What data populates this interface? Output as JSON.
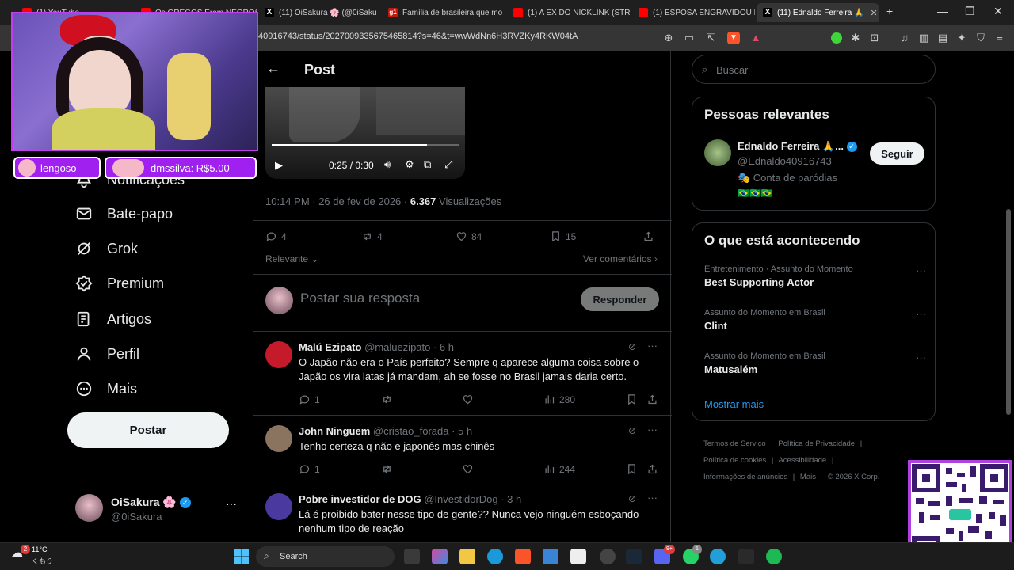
{
  "browser": {
    "tabs": [
      {
        "label": "(1) YouTube",
        "favicon": "youtube-icon",
        "color": "#ff0000"
      },
      {
        "label": "Os GREGOS Eram NEGROS",
        "favicon": "youtube-icon",
        "color": "#ff0000"
      },
      {
        "label": "(11) OiSakura 🌸 (@0iSaku",
        "favicon": "x-icon",
        "color": "#000000"
      },
      {
        "label": "Família de brasileira que mo",
        "favicon": "g1-icon",
        "color": "#c4170c"
      },
      {
        "label": "(1) A EX DO NICKLINK (STR",
        "favicon": "youtube-icon",
        "color": "#ff0000"
      },
      {
        "label": "(1) ESPOSA ENGRAVIDOU D",
        "favicon": "youtube-icon",
        "color": "#ff0000"
      },
      {
        "label": "(11) Ednaldo Ferreira 🙏",
        "favicon": "x-icon",
        "color": "#000000"
      }
    ],
    "new_tab": "+",
    "url": "40916743/status/2027009335675465814?s=46&t=wwWdNn6H3RVZKy4RKW04tA"
  },
  "stream": {
    "donation_left": "lengoso",
    "donation_right": "dmssilva: R$5.00"
  },
  "sidebar": {
    "items": [
      {
        "label": "Notificações",
        "icon": "bell-icon"
      },
      {
        "label": "Bate-papo",
        "icon": "mail-icon"
      },
      {
        "label": "Grok",
        "icon": "grok-icon"
      },
      {
        "label": "Premium",
        "icon": "verified-icon"
      },
      {
        "label": "Artigos",
        "icon": "article-icon"
      },
      {
        "label": "Perfil",
        "icon": "person-icon"
      },
      {
        "label": "Mais",
        "icon": "more-circle-icon"
      }
    ],
    "post_button": "Postar",
    "account": {
      "name": "OiSakura 🌸",
      "handle": "@0iSakura"
    }
  },
  "post": {
    "header_title": "Post",
    "video": {
      "time": "0:25 / 0:30",
      "progress": 0.83
    },
    "meta_time": "10:14 PM · 26 de fev de 2026 · ",
    "views_count": "6.367",
    "views_label": " Visualizações",
    "stats": {
      "replies": "4",
      "reposts": "4",
      "likes": "84",
      "bookmarks": "15"
    },
    "sort_label": "Relevante",
    "see_comments": "Ver comentários",
    "reply_placeholder": "Postar sua resposta",
    "reply_button": "Responder"
  },
  "replies": [
    {
      "name": "Malú Ezipato",
      "handle": "@maluezipato · 6 h",
      "text": "O Japão não era o País perfeito? Sempre q aparece alguma coisa sobre o Japão os vira latas já mandam, ah se fosse no Brasil jamais daria certo.",
      "replies": "1",
      "views": "280",
      "avatar_color": "#c41a2a"
    },
    {
      "name": "John Ninguem",
      "handle": "@cristao_forada · 5 h",
      "text": "Tenho certeza q não e japonês mas chinês",
      "replies": "1",
      "views": "244",
      "avatar_color": "#8a7460"
    },
    {
      "name": "Pobre investidor de DOG",
      "handle": "@InvestidorDog · 3 h",
      "text": "Lá é proibido bater nesse tipo de gente?? Nunca vejo ninguém esboçando nenhum tipo de reação",
      "replies": "",
      "views": "",
      "avatar_color": "#4a3aa0"
    }
  ],
  "search": {
    "placeholder": "Buscar"
  },
  "relevant": {
    "title": "Pessoas relevantes",
    "name": "Ednaldo Ferreira 🙏...",
    "handle": "@Ednaldo40916743",
    "bio": "🎭 Conta de paródias",
    "flags": "🇧🇷🇧🇷🇧🇷",
    "follow_button": "Seguir"
  },
  "happening": {
    "title": "O que está acontecendo",
    "trends": [
      {
        "category": "Entretenimento · Assunto do Momento",
        "topic": "Best Supporting Actor"
      },
      {
        "category": "Assunto do Momento em Brasil",
        "topic": "Clint"
      },
      {
        "category": "Assunto do Momento em Brasil",
        "topic": "Matusalém"
      }
    ],
    "show_more": "Mostrar mais"
  },
  "footer_links": [
    "Termos de Serviço",
    "Política de Privacidade",
    "Política de cookies",
    "Acessibilidade",
    "Informações de anúncios",
    "Mais ···",
    "© 2026 X Corp."
  ],
  "taskbar": {
    "weather_temp": "11°C",
    "weather_label": "くもり",
    "weather_badge": "2",
    "search_label": "Search",
    "discord_badge": "9+",
    "whatsapp_badge": "1"
  },
  "colors": {
    "accent": "#1d9bf0",
    "background": "#000000",
    "border": "#2f3336",
    "muted": "#71767b",
    "stream_frame": "#c43cf0"
  }
}
